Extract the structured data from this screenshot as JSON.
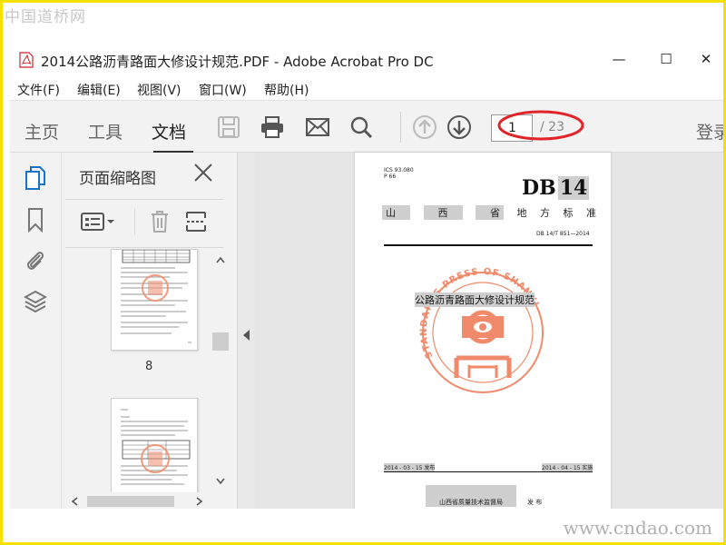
{
  "watermark": {
    "top": "中国道桥网",
    "bottom": "www.cndao.com"
  },
  "window": {
    "title": "2014公路沥青路面大修设计规范.PDF - Adobe Acrobat Pro DC",
    "minimize_glyph": "—",
    "maximize_glyph": "☐",
    "close_glyph": "✕"
  },
  "menu": [
    {
      "label": "文件(F)"
    },
    {
      "label": "编辑(E)"
    },
    {
      "label": "视图(V)"
    },
    {
      "label": "窗口(W)"
    },
    {
      "label": "帮助(H)"
    }
  ],
  "toolbar": {
    "tabs": [
      {
        "label": "主页",
        "active": false
      },
      {
        "label": "工具",
        "active": false
      },
      {
        "label": "文档",
        "active": true
      }
    ],
    "icons": [
      "save-icon",
      "print-icon",
      "email-icon",
      "search-icon",
      "page-up-icon",
      "page-down-icon"
    ],
    "current_page": "1",
    "total_pages": "/ 23",
    "login": "登录"
  },
  "left_rail": {
    "icons": [
      "page-thumbnails-icon",
      "bookmark-icon",
      "attachment-icon",
      "layers-icon"
    ],
    "accent": "#1a73c8"
  },
  "thumbnail_panel": {
    "title": "页面缩略图",
    "thumbs": [
      {
        "label": "8"
      }
    ]
  },
  "document": {
    "header_codes": [
      "ICS 93.080",
      "P 66"
    ],
    "db_prefix": "DB",
    "db_number": "14",
    "province_chars": [
      "山",
      "西",
      "省",
      "地",
      "方",
      "标",
      "准"
    ],
    "standard_number": "DB 14/T 851—2014",
    "title": "公路沥青路面大修设计规范",
    "seal_text": "STANDARDS PRESS OF SHANXI",
    "publish_date": "2014 - 03 - 15 发布",
    "implement_date": "2014 - 04 - 15 实施",
    "issuer": "山西省质量技术监督局",
    "issue_word": "发 布",
    "seal_color": "#f08a6a",
    "annotation_color": "#e0252a"
  }
}
